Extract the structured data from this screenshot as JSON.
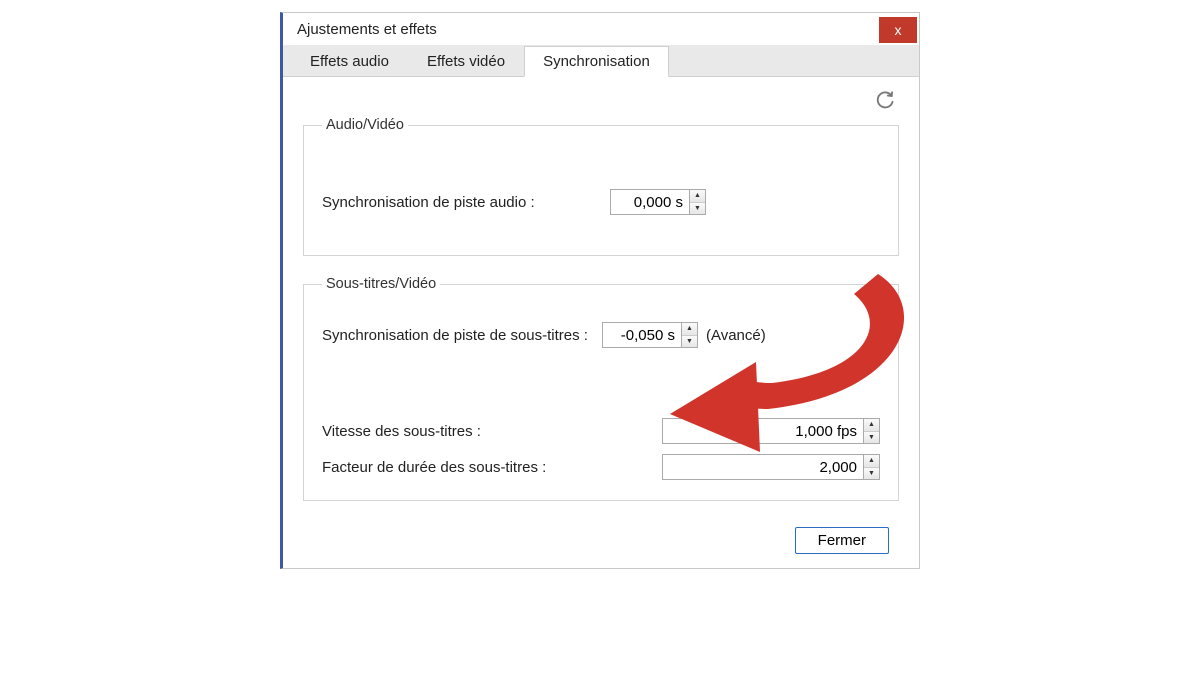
{
  "window": {
    "title": "Ajustements et effets",
    "close_label": "x"
  },
  "tabs": {
    "audio": "Effets audio",
    "video": "Effets vidéo",
    "sync": "Synchronisation"
  },
  "groups": {
    "av": {
      "legend": "Audio/Vidéo",
      "audio_sync_label": "Synchronisation de piste audio :",
      "audio_sync_value": "0,000 s"
    },
    "sub": {
      "legend": "Sous-titres/Vidéo",
      "sub_sync_label": "Synchronisation de piste de sous-titres :",
      "sub_sync_value": "-0,050 s",
      "advanced_hint": "(Avancé)",
      "speed_label": "Vitesse des sous-titres :",
      "speed_value": "1,000 fps",
      "duration_label": "Facteur de durée des sous-titres :",
      "duration_value": "2,000"
    }
  },
  "footer": {
    "close_btn": "Fermer"
  }
}
